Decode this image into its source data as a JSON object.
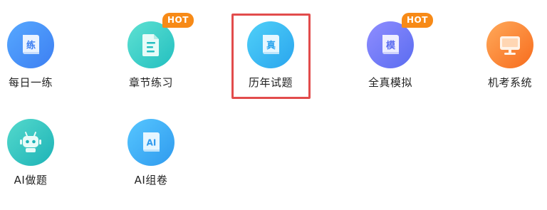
{
  "tiles": [
    {
      "label": "每日一练",
      "glyph": "练",
      "icon": "book-practice-icon"
    },
    {
      "label": "章节练习",
      "badge": "HOT",
      "icon": "document-icon"
    },
    {
      "label": "历年试题",
      "glyph": "真",
      "icon": "book-exam-icon",
      "selected": true
    },
    {
      "label": "全真模拟",
      "glyph": "模",
      "badge": "HOT",
      "icon": "book-mock-icon"
    },
    {
      "label": "机考系统",
      "icon": "monitor-icon"
    },
    {
      "label": "AI做题",
      "icon": "robot-icon"
    },
    {
      "label": "AI组卷",
      "glyph": "AI",
      "icon": "book-ai-icon"
    }
  ],
  "colors": {
    "hot_badge": "#f78a17",
    "selection_border": "#e24c4c",
    "label_text": "#222222"
  }
}
